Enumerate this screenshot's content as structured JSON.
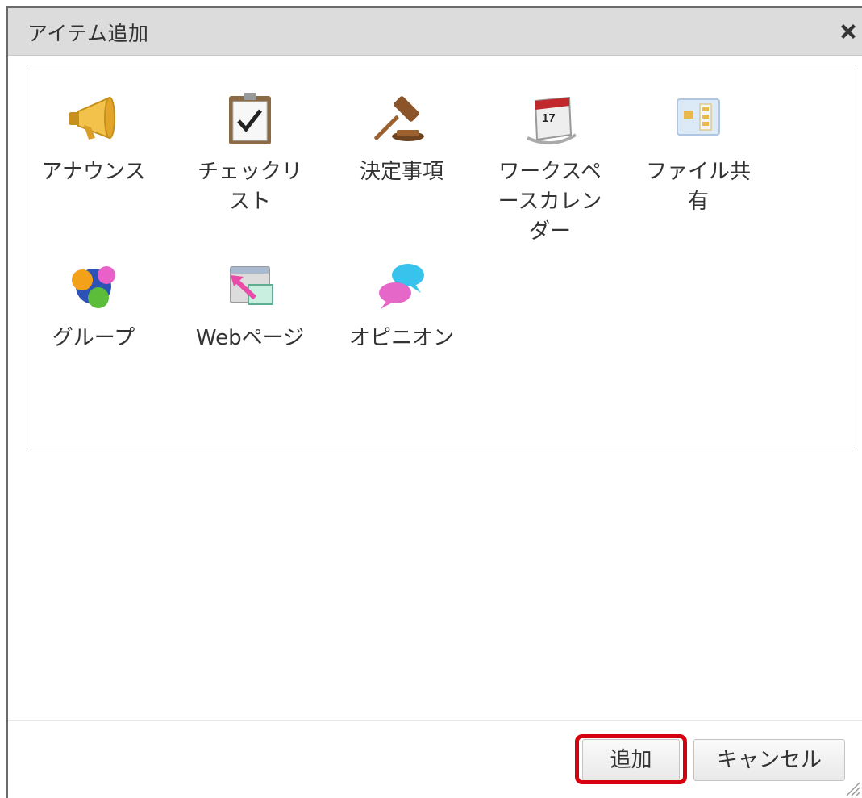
{
  "dialog": {
    "title": "アイテム追加",
    "close_icon": "close-icon"
  },
  "items": [
    {
      "label": "アナウンス",
      "icon": "megaphone-icon"
    },
    {
      "label": "チェックリスト",
      "icon": "checklist-icon"
    },
    {
      "label": "決定事項",
      "icon": "gavel-icon"
    },
    {
      "label": "ワークスペースカレンダー",
      "icon": "calendar-icon"
    },
    {
      "label": "ファイル共有",
      "icon": "file-share-icon"
    },
    {
      "label": "グループ",
      "icon": "group-icon"
    },
    {
      "label": "Webページ",
      "icon": "webpage-icon"
    },
    {
      "label": "オピニオン",
      "icon": "opinion-icon"
    }
  ],
  "footer": {
    "add_label": "追加",
    "cancel_label": "キャンセル"
  },
  "colors": {
    "highlight": "#d7000f",
    "titlebar": "#dcdcdc"
  }
}
